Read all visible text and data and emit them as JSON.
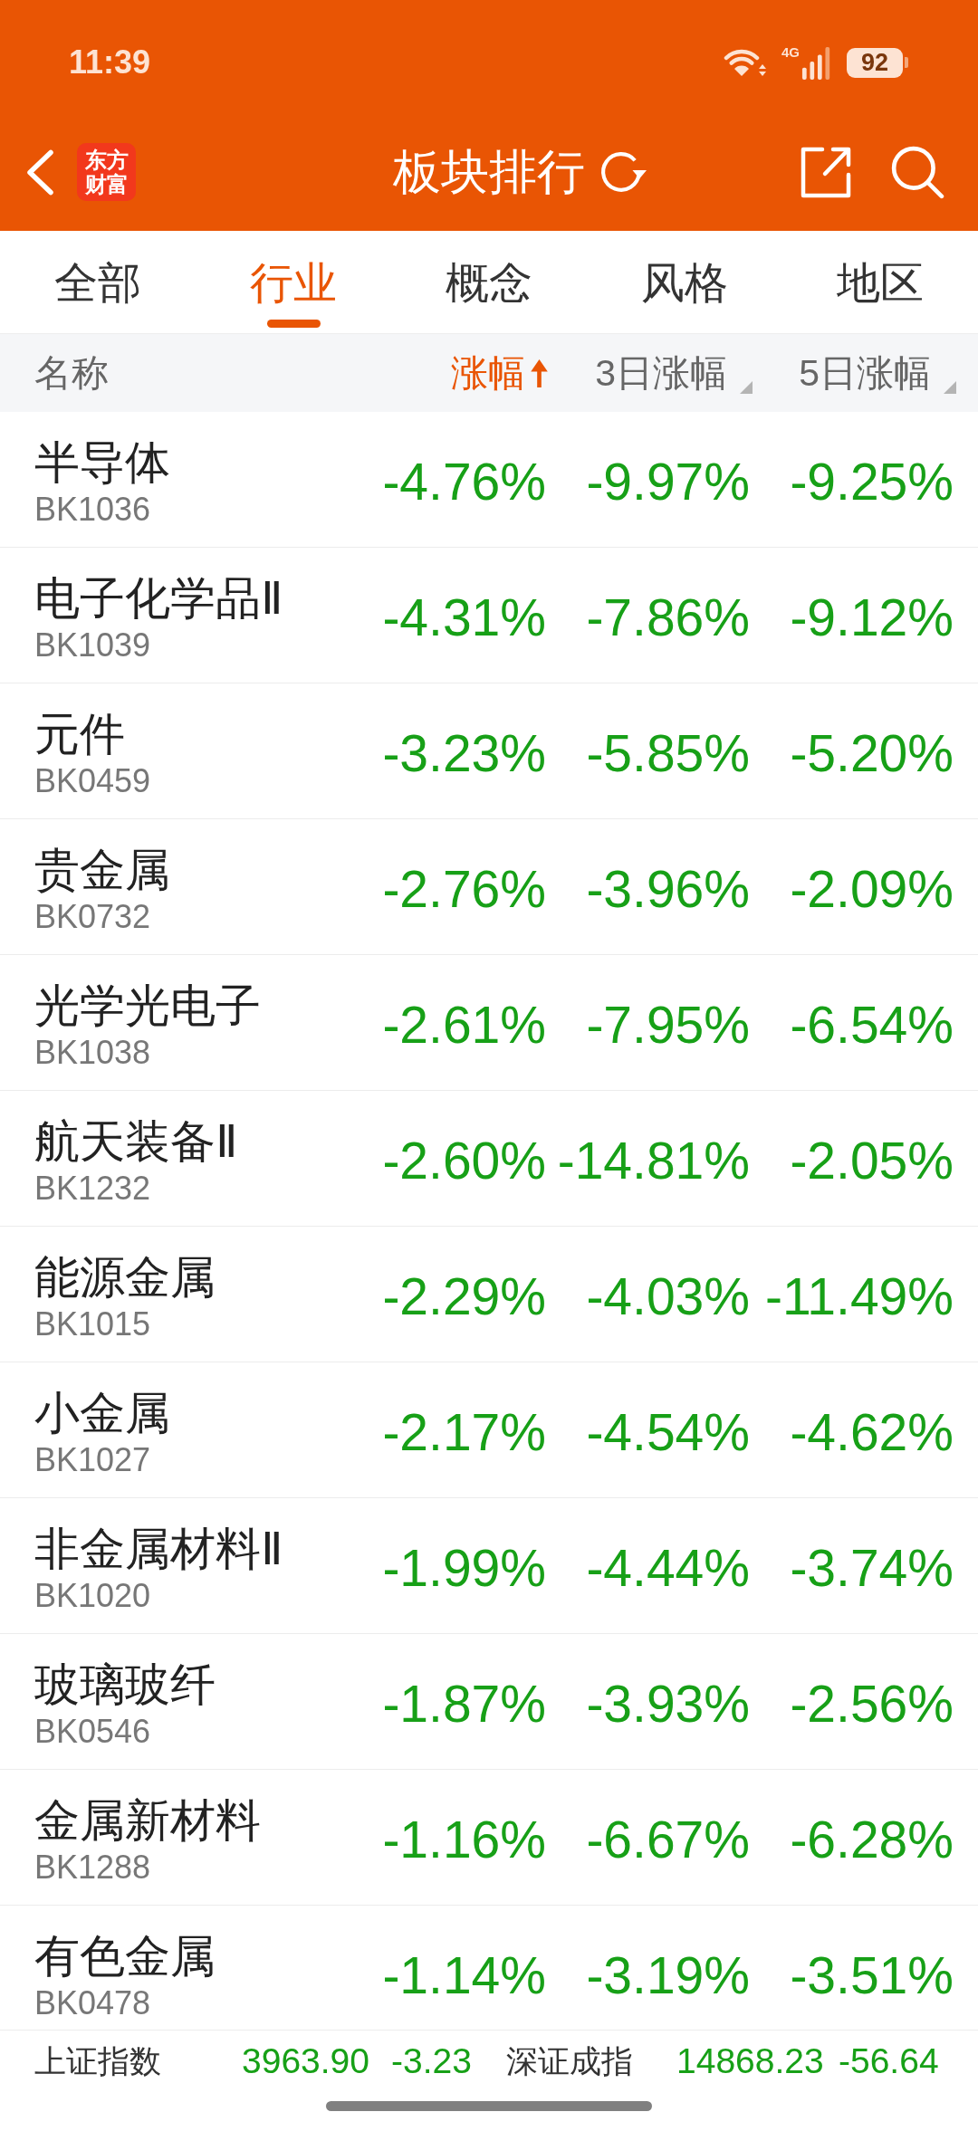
{
  "status_bar": {
    "time": "11:39",
    "network": "4G",
    "battery": "92"
  },
  "nav_bar": {
    "logo": "东方财富",
    "title": "板块排行"
  },
  "tabs": [
    {
      "label": "全部",
      "selected": false
    },
    {
      "label": "行业",
      "selected": true
    },
    {
      "label": "概念",
      "selected": false
    },
    {
      "label": "风格",
      "selected": false
    },
    {
      "label": "地区",
      "selected": false
    }
  ],
  "table": {
    "sort_ascending": true,
    "columns": [
      {
        "label": "名称",
        "sortable": false,
        "selected": false
      },
      {
        "label": "涨幅",
        "sortable": true,
        "selected": true
      },
      {
        "label": "3日涨幅",
        "sortable": true,
        "selected": false
      },
      {
        "label": "5日涨幅",
        "sortable": true,
        "selected": false
      }
    ],
    "rows": [
      {
        "name": "半导体",
        "code": "BK1036",
        "change": "-4.76%",
        "change_3d": "-9.97%",
        "change_5d": "-9.25%"
      },
      {
        "name": "电子化学品Ⅱ",
        "code": "BK1039",
        "change": "-4.31%",
        "change_3d": "-7.86%",
        "change_5d": "-9.12%"
      },
      {
        "name": "元件",
        "code": "BK0459",
        "change": "-3.23%",
        "change_3d": "-5.85%",
        "change_5d": "-5.20%"
      },
      {
        "name": "贵金属",
        "code": "BK0732",
        "change": "-2.76%",
        "change_3d": "-3.96%",
        "change_5d": "-2.09%"
      },
      {
        "name": "光学光电子",
        "code": "BK1038",
        "change": "-2.61%",
        "change_3d": "-7.95%",
        "change_5d": "-6.54%"
      },
      {
        "name": "航天装备Ⅱ",
        "code": "BK1232",
        "change": "-2.60%",
        "change_3d": "-14.81%",
        "change_5d": "-2.05%"
      },
      {
        "name": "能源金属",
        "code": "BK1015",
        "change": "-2.29%",
        "change_3d": "-4.03%",
        "change_5d": "-11.49%"
      },
      {
        "name": "小金属",
        "code": "BK1027",
        "change": "-2.17%",
        "change_3d": "-4.54%",
        "change_5d": "-4.62%"
      },
      {
        "name": "非金属材料Ⅱ",
        "code": "BK1020",
        "change": "-1.99%",
        "change_3d": "-4.44%",
        "change_5d": "-3.74%"
      },
      {
        "name": "玻璃玻纤",
        "code": "BK0546",
        "change": "-1.87%",
        "change_3d": "-3.93%",
        "change_5d": "-2.56%"
      },
      {
        "name": "金属新材料",
        "code": "BK1288",
        "change": "-1.16%",
        "change_3d": "-6.67%",
        "change_5d": "-6.28%"
      },
      {
        "name": "有色金属",
        "code": "BK0478",
        "change": "-1.14%",
        "change_3d": "-3.19%",
        "change_5d": "-3.51%"
      }
    ]
  },
  "index_bar": [
    {
      "name": "上证指数",
      "value": "3963.90",
      "change": "-3.23"
    },
    {
      "name": "深证成指",
      "value": "14868.23",
      "change": "-56.64"
    }
  ]
}
